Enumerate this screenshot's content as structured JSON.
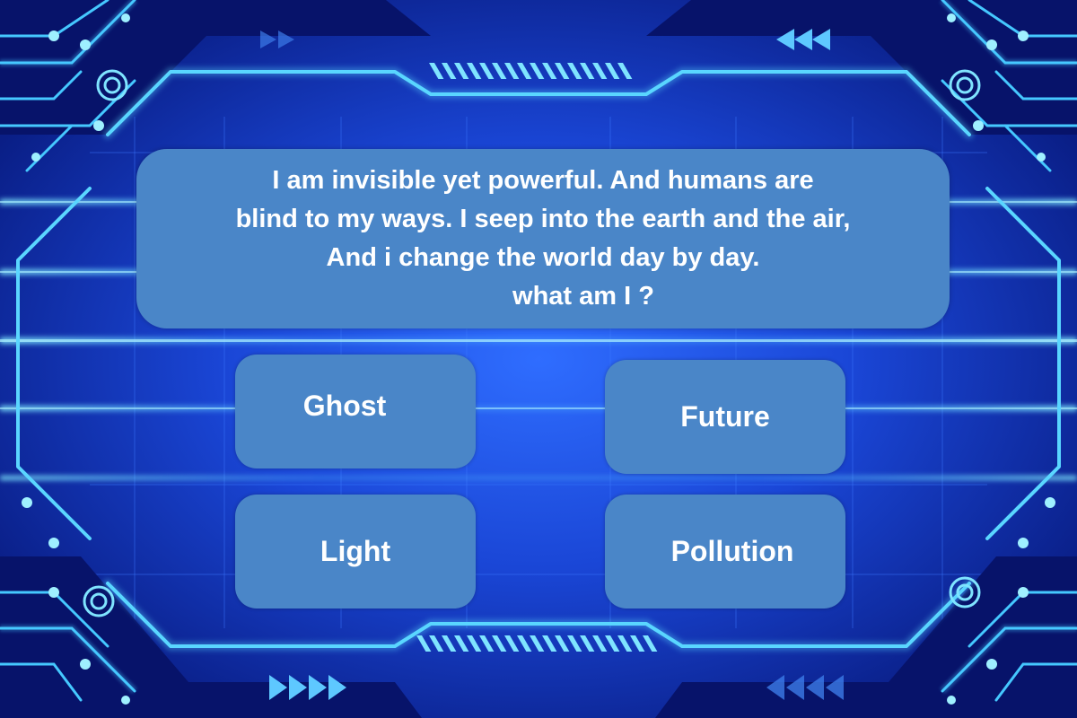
{
  "question": {
    "lines": [
      "I am invisible yet powerful. And humans are",
      "blind to my ways. I seep into the earth and the air,",
      "And i change the world day by day.",
      "what am I ?"
    ]
  },
  "answers": [
    {
      "label": "Ghost"
    },
    {
      "label": "Future"
    },
    {
      "label": "Light"
    },
    {
      "label": "Pollution"
    }
  ],
  "colors": {
    "background_deep": "#0a1f8f",
    "background_glow": "#2f7cff",
    "circuit_line": "#4fd2ff",
    "panel": "#4a86c8",
    "text": "#ffffff"
  },
  "icons": {
    "play_arrows": "triangle-right-icon",
    "rewind_arrows": "triangle-left-icon",
    "circuit_nodes": "circle-node-icon"
  }
}
